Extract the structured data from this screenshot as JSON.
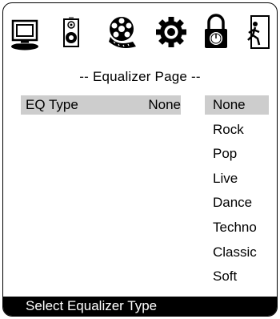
{
  "toolbar": {
    "icons": [
      "tv-icon",
      "speaker-icon",
      "film-reel-icon",
      "gear-icon",
      "lock-icon",
      "exit-icon"
    ]
  },
  "page": {
    "title": "-- Equalizer Page --"
  },
  "eq_setting": {
    "label": "EQ Type",
    "value": "None"
  },
  "options": [
    "None",
    "Rock",
    "Pop",
    "Live",
    "Dance",
    "Techno",
    "Classic",
    "Soft"
  ],
  "status": {
    "text": "Select Equalizer Type"
  }
}
